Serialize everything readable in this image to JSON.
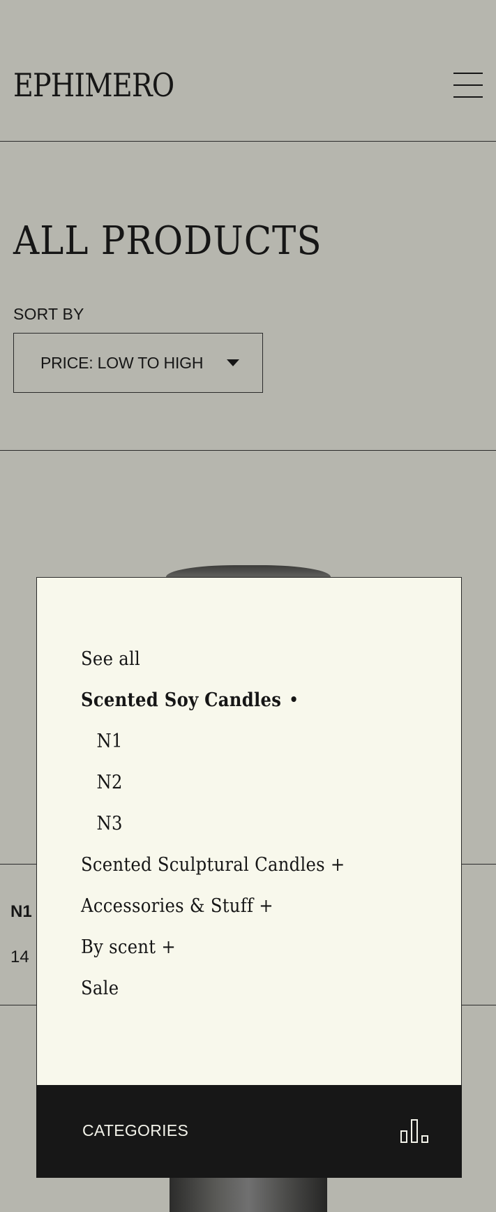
{
  "header": {
    "logo": "EPHIMERO",
    "menu_icon": "hamburger-menu-icon"
  },
  "page": {
    "title": "ALL PRODUCTS"
  },
  "sort": {
    "label": "SORT BY",
    "selected": "PRICE: LOW TO HIGH",
    "caret_icon": "caret-down-icon"
  },
  "product": {
    "name": "N1",
    "price": "14"
  },
  "categories": {
    "items": [
      {
        "label": "See all"
      },
      {
        "label": "Scented Soy Candles"
      },
      {
        "label": "N1"
      },
      {
        "label": "N2"
      },
      {
        "label": "N3"
      },
      {
        "label": "Scented Sculptural Candles +"
      },
      {
        "label": "Accessories & Stuff +"
      },
      {
        "label": "By scent +"
      },
      {
        "label": "Sale"
      }
    ],
    "footer_label": "CATEGORIES",
    "footer_icon": "bar-chart-icon"
  },
  "colors": {
    "background": "#b6b6ae",
    "panel": "#f8f8ec",
    "text": "#161616",
    "footer": "#171717",
    "footer_text": "#f3f3ea"
  }
}
